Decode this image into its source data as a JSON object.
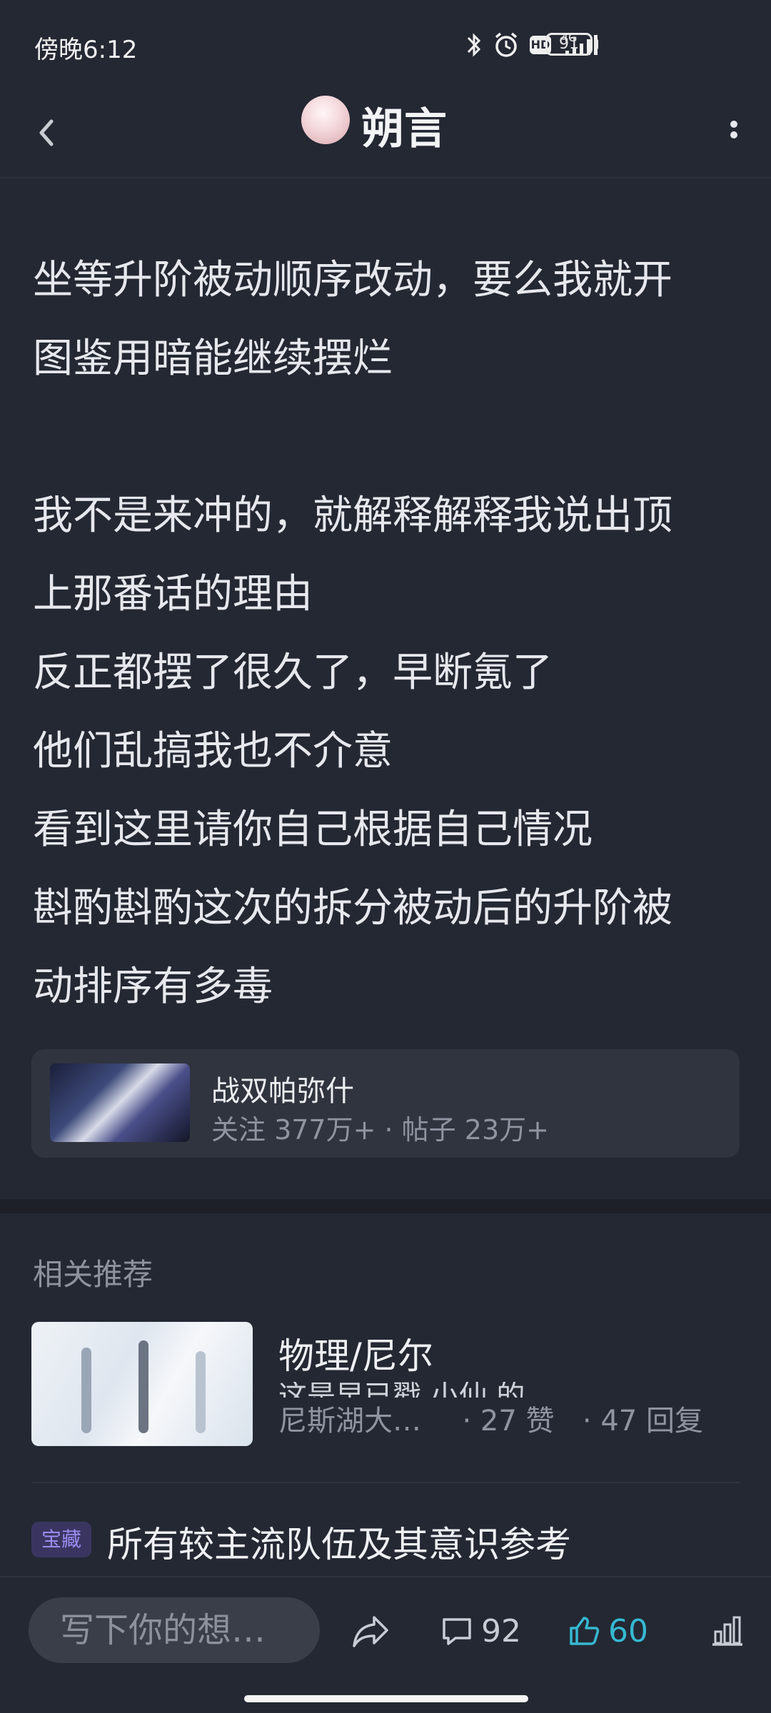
{
  "status_bar": {
    "time": "傍晚6:12",
    "network": "4G",
    "hd": "HD",
    "battery": "91",
    "icons": [
      "bluetooth-icon",
      "alarm-icon",
      "hd-icon",
      "signal-icon",
      "battery-icon"
    ]
  },
  "header": {
    "title": "朔言",
    "back_icon": "chevron-left-icon",
    "more_icon": "more-vertical-icon"
  },
  "post": {
    "lines": [
      "坐等升阶被动顺序改动，要么我就开",
      "图鉴用暗能继续摆烂",
      "",
      "我不是来冲的，就解释解释我说出顶",
      "上那番话的理由",
      "反正都摆了很久了，早断氪了",
      "他们乱搞我也不介意",
      "看到这里请你自己根据自己情况",
      "斟酌斟酌这次的拆分被动后的升阶被",
      "动排序有多毒"
    ]
  },
  "forum": {
    "name": "战双帕弥什",
    "stats": "关注 377万+ · 帖子 23万+"
  },
  "related": {
    "title": "相关推荐",
    "items": [
      {
        "title": "物理/尼尔",
        "snippet": "这是早已戳 小仙    的",
        "author": "尼斯湖大…",
        "likes": "· 27 赞",
        "replies": "· 47 回复"
      },
      {
        "badge": "宝藏",
        "title": "所有较主流队伍及其意识参考"
      }
    ]
  },
  "bottom_bar": {
    "input_placeholder": "写下你的想…",
    "comment_count": "92",
    "like_count": "60",
    "accent_color": "#35b9d2"
  }
}
